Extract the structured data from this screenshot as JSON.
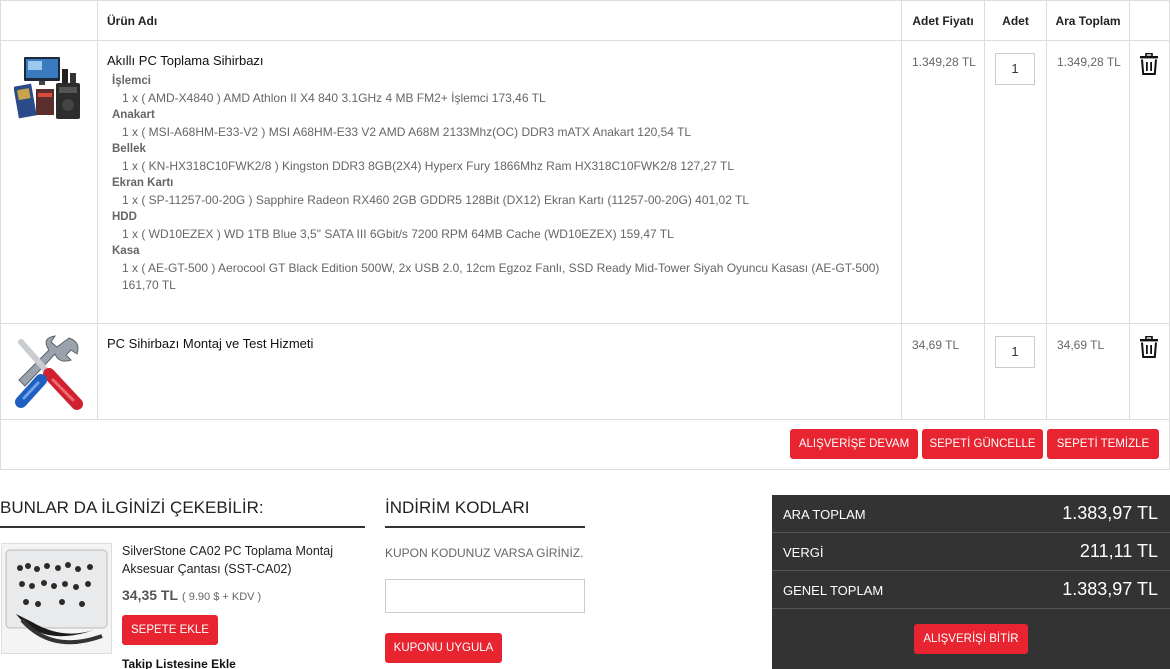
{
  "table": {
    "headers": {
      "product_name": "Ürün Adı",
      "unit_price": "Adet Fiyatı",
      "quantity": "Adet",
      "subtotal": "Ara Toplam"
    }
  },
  "items": [
    {
      "name": "Akıllı PC Toplama Sihirbazı",
      "unit_price": "1.349,28 TL",
      "quantity": "1",
      "subtotal": "1.349,28 TL",
      "components": [
        {
          "category": "İşlemci",
          "lines": [
            "1 x ( AMD-X4840 ) AMD Athlon II X4 840 3.1GHz 4 MB FM2+ İşlemci 173,46 TL"
          ]
        },
        {
          "category": "Anakart",
          "lines": [
            "1 x ( MSI-A68HM-E33-V2 ) MSI A68HM-E33 V2 AMD A68M 2133Mhz(OC) DDR3 mATX Anakart 120,54 TL"
          ]
        },
        {
          "category": "Bellek",
          "lines": [
            "1 x ( KN-HX318C10FWK2/8 ) Kingston DDR3 8GB(2X4) Hyperx Fury 1866Mhz Ram HX318C10FWK2/8 127,27 TL"
          ]
        },
        {
          "category": "Ekran Kartı",
          "lines": [
            "1 x ( SP-11257-00-20G ) Sapphire Radeon RX460 2GB GDDR5 128Bit (DX12) Ekran Kartı (11257-00-20G) 401,02 TL"
          ]
        },
        {
          "category": "HDD",
          "lines": [
            "1 x ( WD10EZEX ) WD 1TB Blue 3,5\" SATA III 6Gbit/s 7200 RPM 64MB Cache (WD10EZEX) 159,47 TL"
          ]
        },
        {
          "category": "Kasa",
          "lines": [
            "1 x ( AE-GT-500 ) Aerocool GT Black Edition 500W, 2x USB 2.0, 12cm Egzoz Fanlı, SSD Ready Mid-Tower Siyah Oyuncu Kasası (AE-GT-500) 161,70 TL"
          ]
        }
      ]
    },
    {
      "name": "PC Sihirbazı Montaj ve Test Hizmeti",
      "unit_price": "34,69 TL",
      "quantity": "1",
      "subtotal": "34,69 TL"
    }
  ],
  "cart_buttons": {
    "continue": "ALIŞVERİŞE DEVAM",
    "update": "SEPETİ GÜNCELLE",
    "clear": "SEPETİ TEMİZLE"
  },
  "suggestions": {
    "title": "BUNLAR DA İLGİNİZİ ÇEKEBİLİR:",
    "product": {
      "name": "SilverStone CA02 PC Toplama Montaj Aksesuar Çantası (SST-CA02)",
      "price": "34,35 TL",
      "price_note": "( 9.90 $ + KDV )",
      "add_button": "SEPETE EKLE",
      "watch_link": "Takip Listesine Ekle"
    }
  },
  "coupon": {
    "title": "İNDİRİM KODLARI",
    "hint": "KUPON KODUNUZ VARSA GİRİNİZ.",
    "input_value": "",
    "apply_button": "KUPONU UYGULA"
  },
  "totals": {
    "subtotal_label": "ARA TOPLAM",
    "subtotal_value": "1.383,97 TL",
    "tax_label": "VERGİ",
    "tax_value": "211,11 TL",
    "grand_label": "GENEL TOPLAM",
    "grand_value": "1.383,97 TL",
    "checkout_button": "ALIŞVERİŞİ BİTİR"
  },
  "colors": {
    "accent": "#e82431",
    "totals_bg": "#333333",
    "border": "#dddddd"
  },
  "icons": [
    "trash-icon",
    "pc-bundle-thumbnail",
    "tools-thumbnail",
    "accessory-case-thumbnail"
  ]
}
